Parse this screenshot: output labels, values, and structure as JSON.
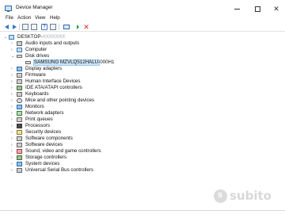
{
  "window": {
    "title": "Device Manager"
  },
  "menu": [
    "File",
    "Action",
    "View",
    "Help"
  ],
  "toolbar": {
    "icons": [
      "back-arrow-icon",
      "forward-arrow-icon",
      "properties-icon",
      "view-icon",
      "help-icon",
      "monitor-icon",
      "enable-device-icon",
      "uninstall-icon"
    ]
  },
  "tree": {
    "root": "DESKTOP-",
    "root_suffix": "XXXXXXX",
    "categories": [
      {
        "label": "Audio inputs and outputs",
        "icon": "speaker-icon"
      },
      {
        "label": "Computer",
        "icon": "computer-icon"
      },
      {
        "label": "Disk drives",
        "icon": "disk-drive-icon",
        "expanded": true
      },
      {
        "label": "Display adapters",
        "icon": "display-adapter-icon"
      },
      {
        "label": "Firmware",
        "icon": "firmware-icon"
      },
      {
        "label": "Human Interface Devices",
        "icon": "hid-icon"
      },
      {
        "label": "IDE ATA/ATAPI controllers",
        "icon": "ide-controller-icon"
      },
      {
        "label": "Keyboards",
        "icon": "keyboard-icon"
      },
      {
        "label": "Mice and other pointing devices",
        "icon": "mouse-icon"
      },
      {
        "label": "Monitors",
        "icon": "monitor-icon"
      },
      {
        "label": "Network adapters",
        "icon": "network-adapter-icon"
      },
      {
        "label": "Print queues",
        "icon": "printer-icon"
      },
      {
        "label": "Processors",
        "icon": "processor-icon"
      },
      {
        "label": "Security devices",
        "icon": "security-device-icon"
      },
      {
        "label": "Software components",
        "icon": "software-component-icon"
      },
      {
        "label": "Software devices",
        "icon": "software-device-icon"
      },
      {
        "label": "Sound, video and game controllers",
        "icon": "sound-icon"
      },
      {
        "label": "Storage controllers",
        "icon": "storage-controller-icon"
      },
      {
        "label": "System devices",
        "icon": "system-device-icon"
      },
      {
        "label": "Universal Serial Bus controllers",
        "icon": "usb-icon"
      }
    ],
    "disk_child": "SAMSUNG MZVLQ512HALU-000H1"
  },
  "watermark": "subito"
}
